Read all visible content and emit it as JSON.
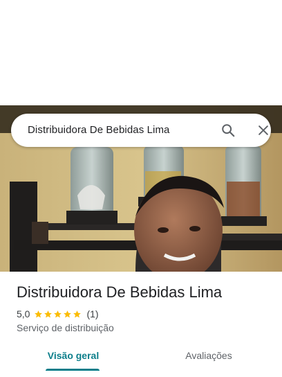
{
  "search": {
    "query": "Distribuidora De Bebidas Lima",
    "search_icon": "search-icon",
    "close_icon": "close-icon"
  },
  "hero": {
    "photo": "storefront-photo"
  },
  "place": {
    "title": "Distribuidora De Bebidas Lima",
    "rating_value": "5,0",
    "rating_stars": 5,
    "review_count": "(1)",
    "category": "Serviço de distribuição"
  },
  "tabs": [
    {
      "label": "Visão geral",
      "active": true
    },
    {
      "label": "Avaliações",
      "active": false
    }
  ],
  "colors": {
    "accent": "#0b7e8a",
    "star": "#fbbc04",
    "text_primary": "#202124",
    "text_secondary": "#5f6368"
  }
}
